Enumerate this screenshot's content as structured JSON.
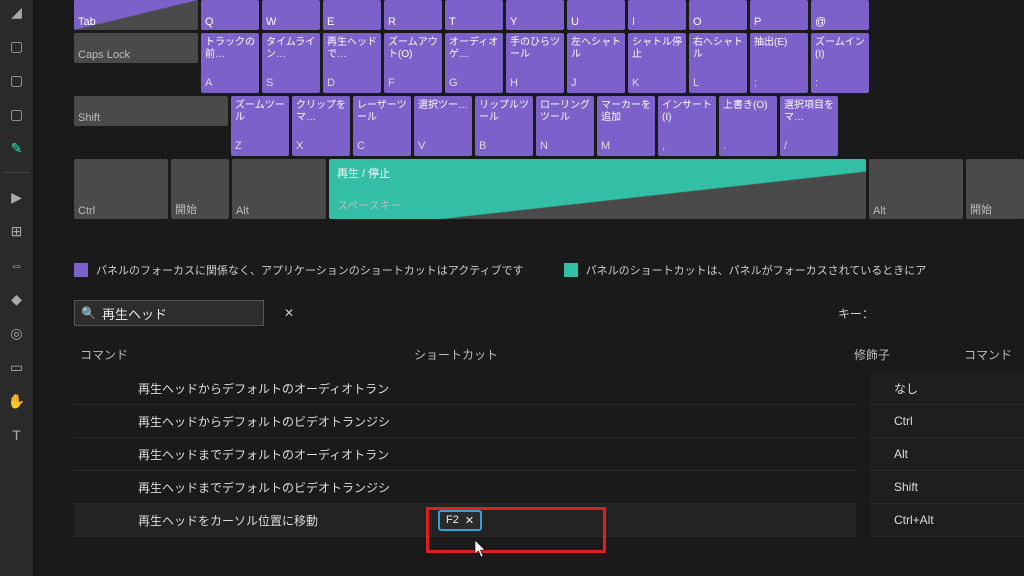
{
  "keyboard": {
    "row1": {
      "tab": "Tab",
      "keys": [
        "Q",
        "W",
        "E",
        "R",
        "T",
        "Y",
        "U",
        "I",
        "O",
        "P",
        "@"
      ]
    },
    "row2": {
      "caps": "Caps Lock",
      "functions": [
        {
          "top": "トラックの前…",
          "bot": "A"
        },
        {
          "top": "タイムライン…",
          "bot": "S"
        },
        {
          "top": "再生ヘッドで…",
          "bot": "D"
        },
        {
          "top": "ズームアウト(O)",
          "bot": "F"
        },
        {
          "top": "オーディオゲ…",
          "bot": "G"
        },
        {
          "top": "手のひらツール",
          "bot": "H"
        },
        {
          "top": "左へシャトル",
          "bot": "J"
        },
        {
          "top": "シャトル停止",
          "bot": "K"
        },
        {
          "top": "右へシャトル",
          "bot": "L"
        },
        {
          "top": "抽出(E)",
          "bot": ";"
        },
        {
          "top": "ズームイン(I)",
          "bot": ":"
        }
      ]
    },
    "row3": {
      "shift": "Shift",
      "functions": [
        {
          "top": "ズームツール",
          "bot": "Z"
        },
        {
          "top": "クリップをマ…",
          "bot": "X"
        },
        {
          "top": "レーザーツール",
          "bot": "C"
        },
        {
          "top": "選択ツー…",
          "bot": "V"
        },
        {
          "top": "リップルツール",
          "bot": "B"
        },
        {
          "top": "ローリングツール",
          "bot": "N"
        },
        {
          "top": "マーカーを追加",
          "bot": "M"
        },
        {
          "top": "インサート(I)",
          "bot": ","
        },
        {
          "top": "上書き(O)",
          "bot": "."
        },
        {
          "top": "選択項目をマ…",
          "bot": "/"
        }
      ]
    },
    "row4": {
      "ctrl": "Ctrl",
      "start": "開始",
      "alt": "Alt",
      "space_top": "再生 / 停止",
      "space_bot": "スペースキー",
      "alt2": "Alt",
      "start2": "開始"
    }
  },
  "legend": {
    "app": "パネルのフォーカスに関係なく、アプリケーションのショートカットはアクティブです",
    "panel": "パネルのショートカットは、パネルがフォーカスされているときにア"
  },
  "search": {
    "value": "再生ヘッド"
  },
  "key_section_label": "キー：",
  "columns": {
    "cmd": "コマンド",
    "shortcut": "ショートカット",
    "modifier": "修飾子",
    "cmd2": "コマンド"
  },
  "commands": [
    "再生ヘッドからデフォルトのオーディオトラン",
    "再生ヘッドからデフォルトのビデオトランジシ",
    "再生ヘッドまでデフォルトのオーディオトラン",
    "再生ヘッドまでデフォルトのビデオトランジシ",
    "再生ヘッドをカーソル位置に移動"
  ],
  "active_shortcut": "F2",
  "modifiers": [
    "なし",
    "Ctrl",
    "Alt",
    "Shift",
    "Ctrl+Alt"
  ]
}
